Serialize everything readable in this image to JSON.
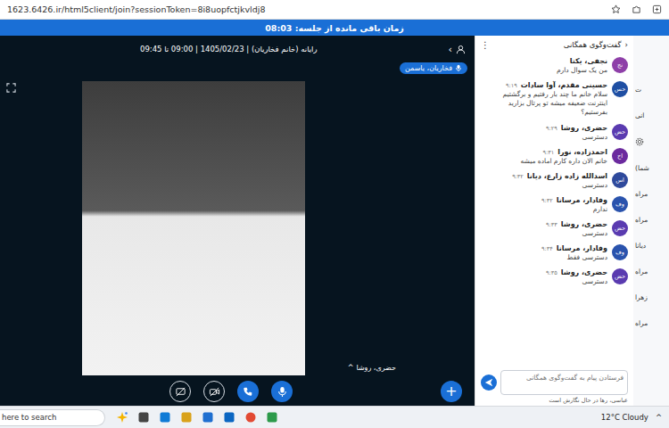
{
  "browser": {
    "url": "1623.6426.ir/html5client/join?sessionToken=8i8uopfctjkvldj8"
  },
  "banner": {
    "text": "زمان باقی مانده از جلسه: 08:03"
  },
  "meeting": {
    "title": "رایانه (خانم فخاریان) | 1405/02/23 | 09:00 تا 09:45",
    "nav": "‹",
    "presenter": "فخاریان، یاسمن",
    "video_label": "حضری، روشا",
    "video_caret": "^",
    "controls": [
      {
        "kind": "share",
        "on": false
      },
      {
        "kind": "camera",
        "on": false
      },
      {
        "kind": "phone",
        "on": true
      },
      {
        "kind": "mic",
        "on": true
      }
    ],
    "plus": "+"
  },
  "chat": {
    "title": "گفت‌وگوی همگانی",
    "back": "‹",
    "menu": "⋮",
    "messages": [
      {
        "initials": "نج",
        "name": "نجفی، یکتا",
        "text": "من یک سوال دارم",
        "color": "#8e3fa8"
      },
      {
        "initials": "حس",
        "name": "حسینی مقدم، آوا سادات",
        "time": "۹:۱۹",
        "text": "سلام خانم ما چند بار رفتیم و برگشتیم اینترنت ضعیفه میشه تو پرتال بزارید بفرستیم؟",
        "color": "#1f4fa3"
      },
      {
        "initials": "حض",
        "name": "حضری، روشا",
        "time": "۹:۲۹",
        "text": "دسترسی",
        "color": "#5a3bb0"
      },
      {
        "initials": "اح",
        "name": "احمدزاده، نورا",
        "time": "۹:۳۱",
        "text": "خانم الان داره کارم اماده میشه",
        "color": "#6b2a9e"
      },
      {
        "initials": "اس",
        "name": "اسدالله زاده زارع، دیانا",
        "time": "۹:۳۲",
        "text": "دسترسی",
        "color": "#2f4a9c"
      },
      {
        "initials": "وف",
        "name": "وفادار، مرسانا",
        "time": "۹:۳۲",
        "text": "ندارم",
        "color": "#2a53ad"
      },
      {
        "initials": "حض",
        "name": "حضری، روشا",
        "time": "۹:۳۳",
        "text": "دسترسی",
        "color": "#5a3bb0"
      },
      {
        "initials": "وف",
        "name": "وفادار، مرسانا",
        "time": "۹:۳۴",
        "text": "دسترسی فقط",
        "color": "#2a53ad"
      },
      {
        "initials": "حض",
        "name": "حضری، روشا",
        "time": "۹:۳۵",
        "text": "دسترسی",
        "color": "#5a3bb0"
      }
    ],
    "placeholder": "فرستادن پیام به گفت‌وگوی همگانی",
    "typing": "عباسی، رها در حال نگارش است"
  },
  "side_panel": {
    "fragments": [
      "ت",
      "انی",
      "شما)",
      "مراه",
      "مراه",
      "دیانا",
      "مراه",
      "زهرا",
      "مراه"
    ]
  },
  "taskbar": {
    "search": "here to search",
    "weather": "12°C Cloudy",
    "tray": "^"
  }
}
